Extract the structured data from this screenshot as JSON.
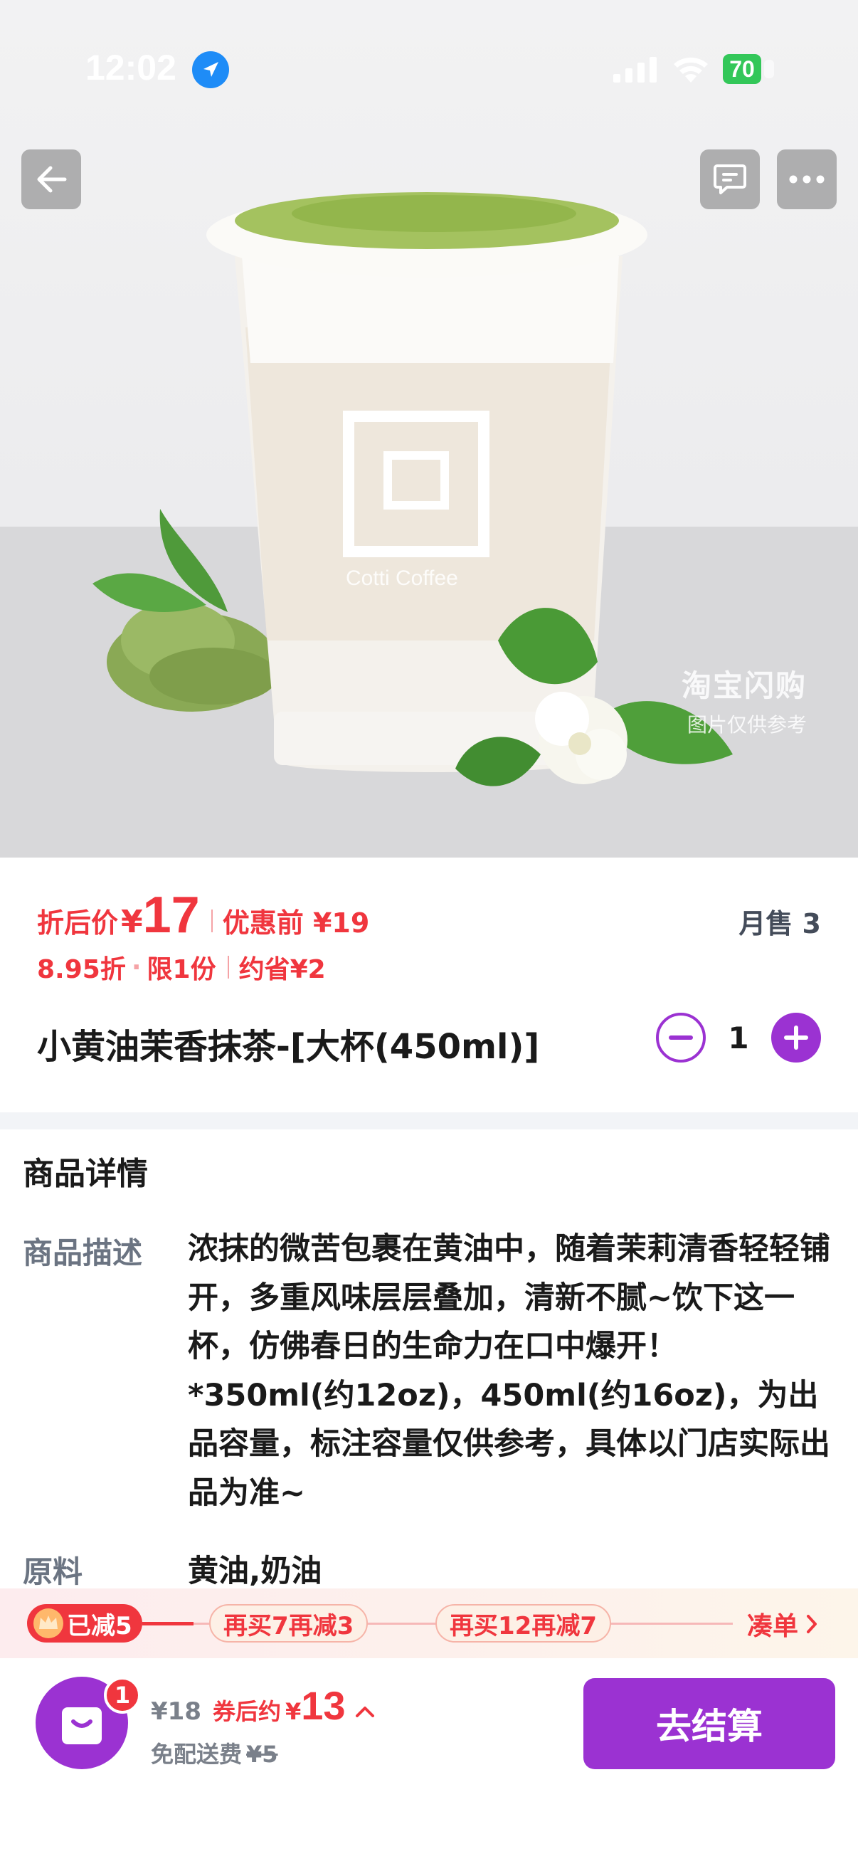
{
  "status_bar": {
    "time": "12:02",
    "battery": "70",
    "icons": [
      "location-arrow-icon",
      "signal-icon",
      "wifi-icon",
      "battery-icon"
    ]
  },
  "nav": {
    "icons": [
      "back-arrow-icon",
      "chat-icon",
      "more-icon"
    ]
  },
  "hero": {
    "brand_text": "Cotti Coffee",
    "watermark_line1": "淘宝闪购",
    "watermark_line2": "图片仅供参考"
  },
  "price": {
    "after_label": "折后价",
    "currency": "¥",
    "after_value": "17",
    "before_label": "优惠前 ¥19",
    "monthly_sales": "月售 3",
    "discount": "8.95折",
    "dot": "·",
    "limit": "限1份",
    "save": "约省¥2"
  },
  "product": {
    "title": "小黄油茉香抹茶-[大杯(450ml)]",
    "quantity": "1"
  },
  "details": {
    "title": "商品详情",
    "desc_label": "商品描述",
    "desc_text": "浓抹的微苦包裹在黄油中，随着茉莉清香轻轻铺开，多重风味层层叠加，清新不腻~饮下这一杯，仿佛春日的生命力在口中爆开！*350ml(约12oz)，450ml(约16oz)，为出品容量，标注容量仅供参考，具体以门店实际出品为准~",
    "ingredients_label": "原料",
    "ingredients": "黄油,奶油"
  },
  "promo": {
    "reached": "已减5",
    "tier1": "再买7再减3",
    "tier2": "再买12再减7",
    "more": "凑单"
  },
  "bottom": {
    "cart_count": "1",
    "original_total": "¥18",
    "coupon_label": "券后约",
    "currency": "¥",
    "final_total": "13",
    "delivery_label": "免配送费",
    "delivery_original": "¥5",
    "checkout": "去结算"
  },
  "colors": {
    "accent_purple": "#9b32d2",
    "price_red": "#f0363e",
    "muted_gray": "#6b7482"
  }
}
